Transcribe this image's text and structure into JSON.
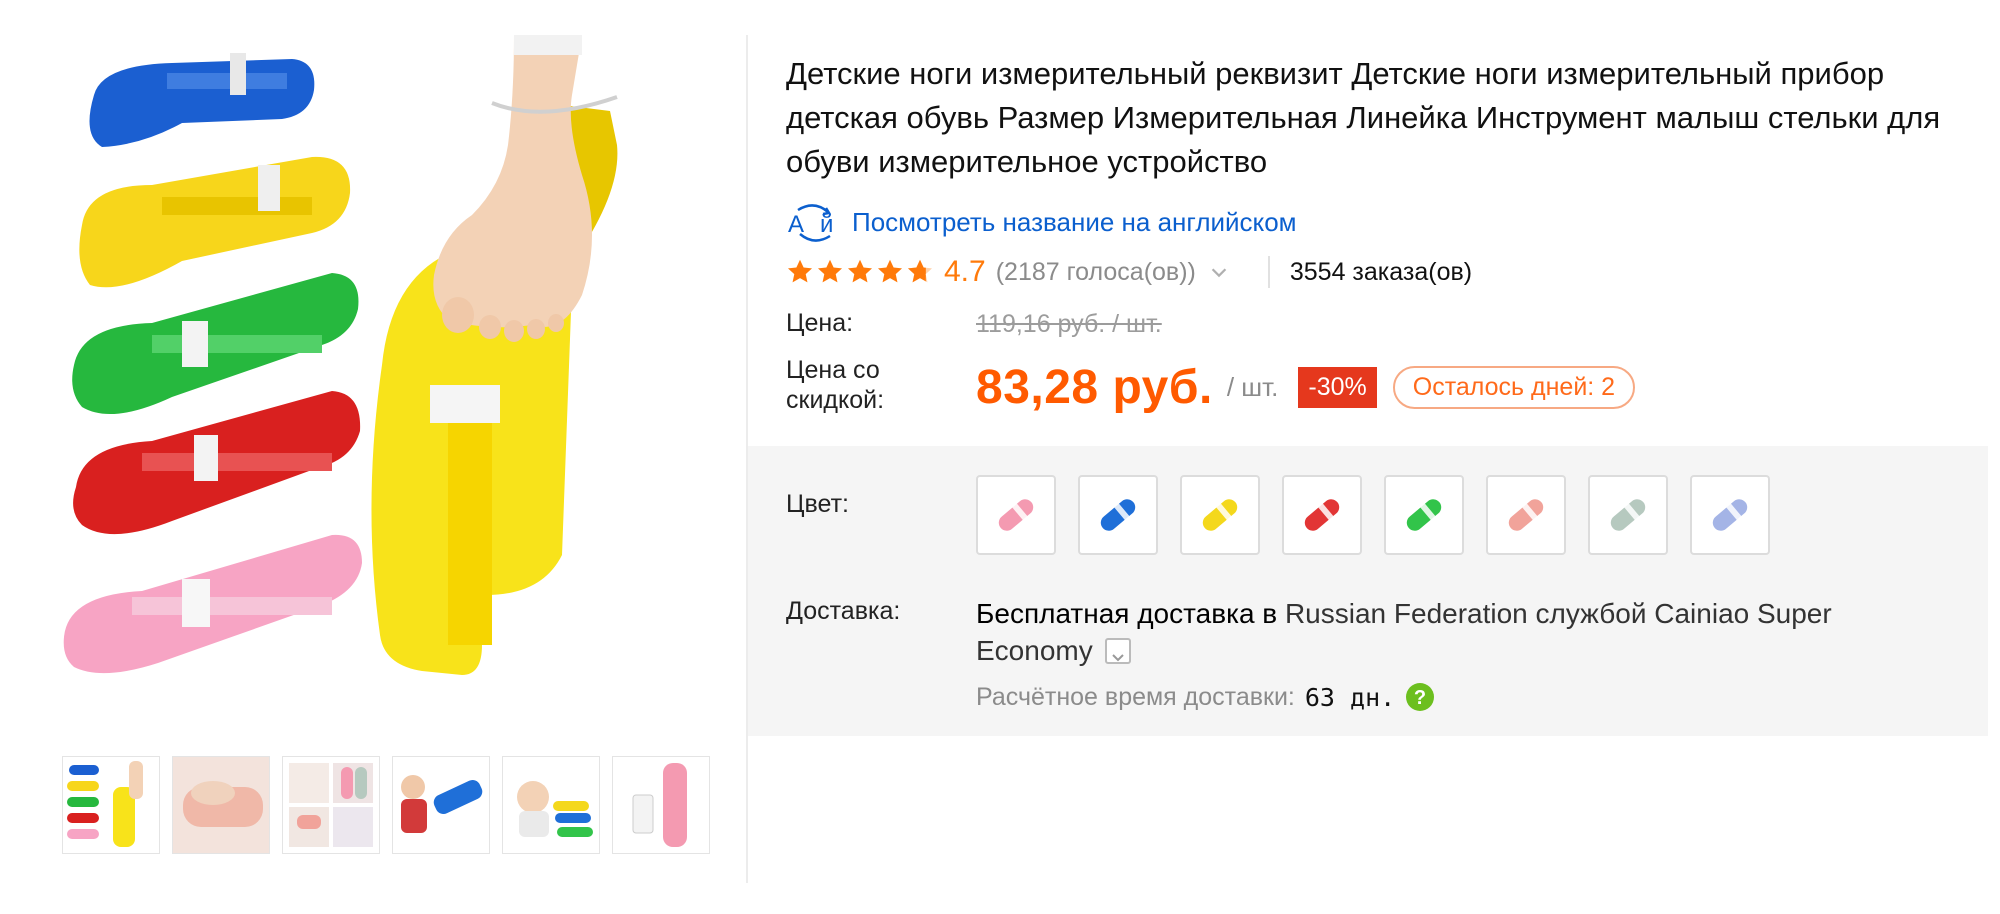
{
  "product": {
    "title": "Детские ноги измерительный реквизит Детские ноги измерительный прибор детская обувь Размер Измерительная Линейка Инструмент малыш стельки для обуви измерительное устройство",
    "translate_link": "Посмотреть название на английском",
    "rating": {
      "value": "4.7",
      "stars": 4.7,
      "votes": "(2187 голоса(ов))",
      "orders": "3554 заказа(ов)"
    },
    "price": {
      "label": "Цена:",
      "old": "119,16 руб. / шт.",
      "discount_label": "Цена со скидкой:",
      "sale": "83,28 руб.",
      "unit": "/ шт.",
      "discount_badge": "-30%",
      "days_left": "Осталось дней: 2"
    },
    "color_label": "Цвет:",
    "colors": [
      {
        "name": "pink",
        "hex": "#f49ab1"
      },
      {
        "name": "blue",
        "hex": "#1f6fd8"
      },
      {
        "name": "yellow",
        "hex": "#f4d81c"
      },
      {
        "name": "red",
        "hex": "#e23535"
      },
      {
        "name": "green",
        "hex": "#32c44a"
      },
      {
        "name": "salmon",
        "hex": "#f1a39a"
      },
      {
        "name": "grey-green",
        "hex": "#b6c9bf"
      },
      {
        "name": "lavender",
        "hex": "#a4b4e6"
      }
    ],
    "delivery": {
      "label": "Доставка:",
      "lead": "Бесплатная доставка в",
      "detail": "Russian Federation службой Cainiao Super Economy",
      "eta_label": "Расчётное время доставки:",
      "eta_value": "63 дн."
    }
  },
  "gallery": {
    "thumbnails": [
      "main-yellow-ruler",
      "pink-ruler-foot",
      "ruler-collage",
      "child-blue-ruler",
      "baby-colored-rulers",
      "pink-ruler-phone"
    ]
  },
  "colors": {
    "accent": "#ff5a00",
    "rating": "#ff7a0a",
    "link": "#0b5fce",
    "badge": "#e5381d",
    "panel": "#f5f5f5"
  }
}
